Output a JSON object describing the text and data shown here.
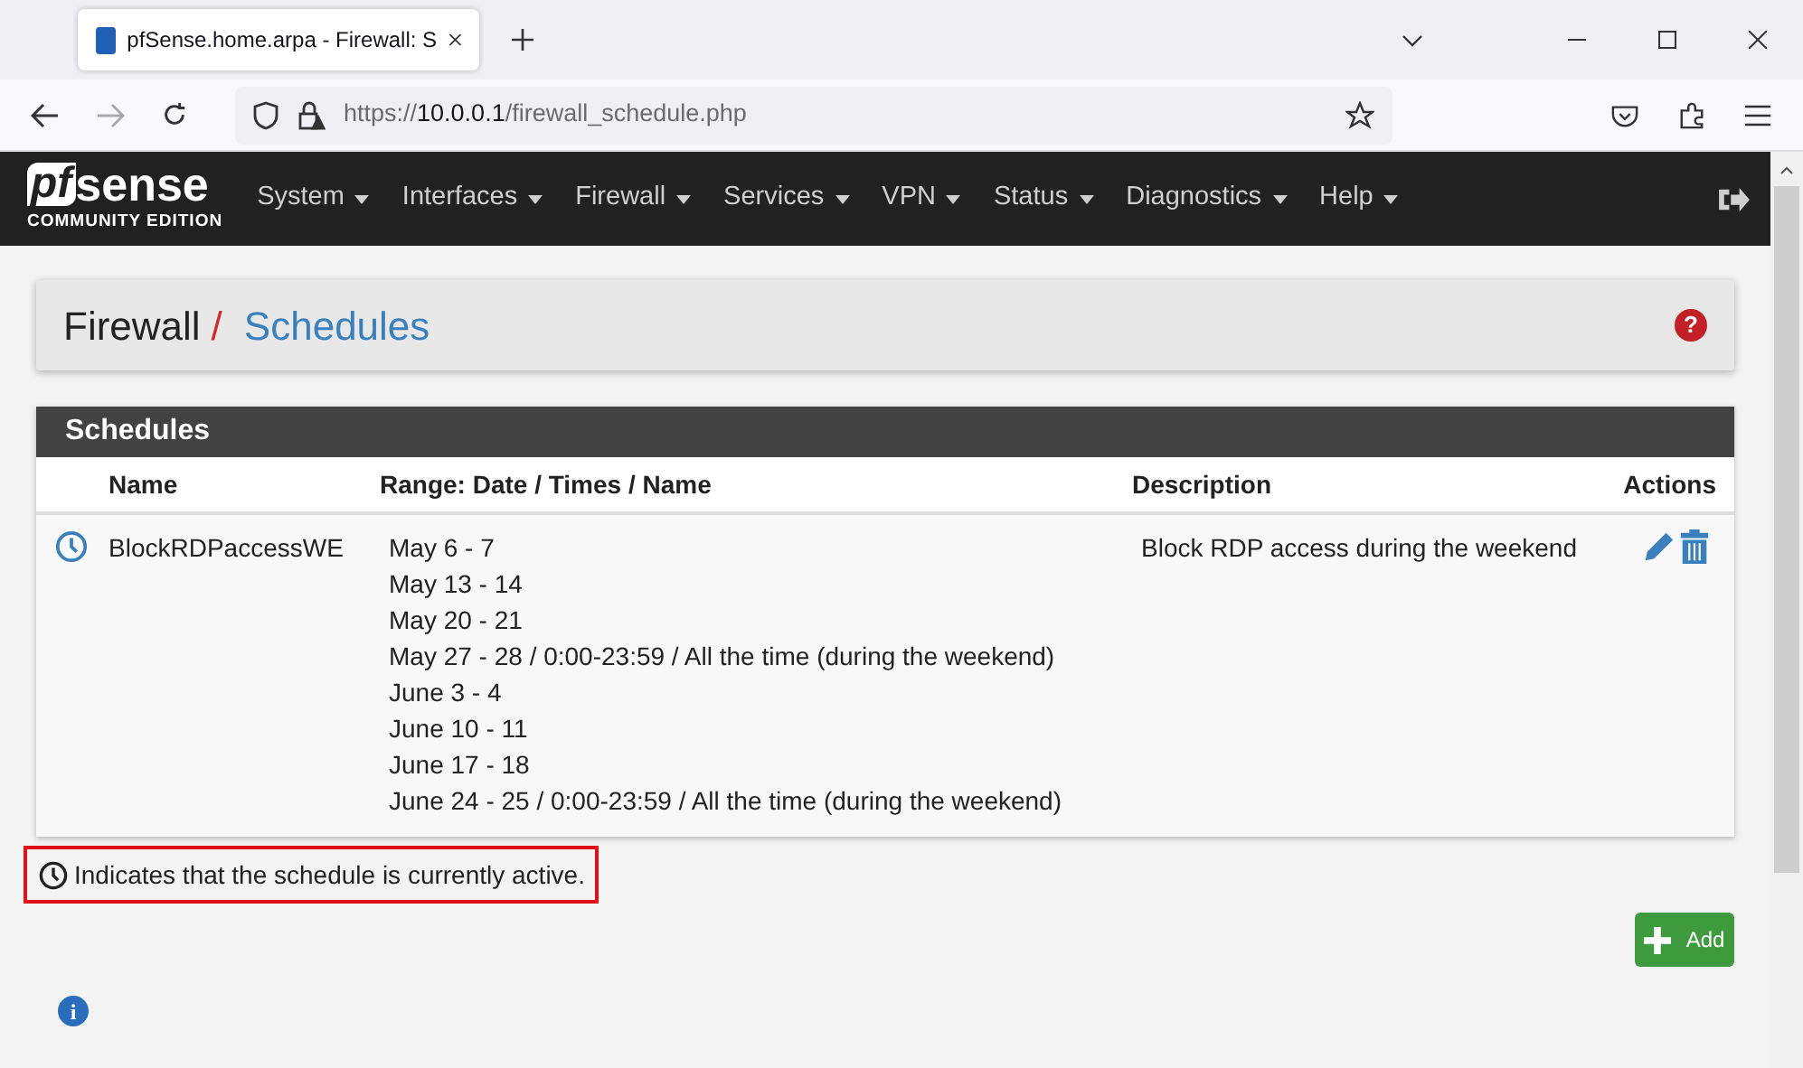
{
  "browser": {
    "tab_title": "pfSense.home.arpa - Firewall: S",
    "url": {
      "scheme": "https://",
      "host": "10.0.0.1",
      "path": "/firewall_schedule.php"
    }
  },
  "logo": {
    "mark": "pf",
    "word": "sense",
    "edition": "COMMUNITY EDITION"
  },
  "nav": [
    "System",
    "Interfaces",
    "Firewall",
    "Services",
    "VPN",
    "Status",
    "Diagnostics",
    "Help"
  ],
  "breadcrumb": {
    "parent": "Firewall",
    "separator": "/",
    "current": "Schedules",
    "help": "?"
  },
  "panel": {
    "title": "Schedules",
    "columns": [
      "Name",
      "Range: Date / Times / Name",
      "Description",
      "Actions"
    ],
    "rows": [
      {
        "active": true,
        "name": "BlockRDPaccessWE",
        "ranges": [
          "May 6 - 7",
          "May 13 - 14",
          "May 20 - 21",
          "May 27 - 28 / 0:00-23:59 / All the time (during the weekend)",
          "June 3 - 4",
          "June 10 - 11",
          "June 17 - 18",
          "June 24 - 25 / 0:00-23:59 / All the time (during the weekend)"
        ],
        "description": "Block RDP access during the weekend"
      }
    ]
  },
  "legend": "Indicates that the schedule is currently active.",
  "add_button": "Add",
  "info": "i"
}
